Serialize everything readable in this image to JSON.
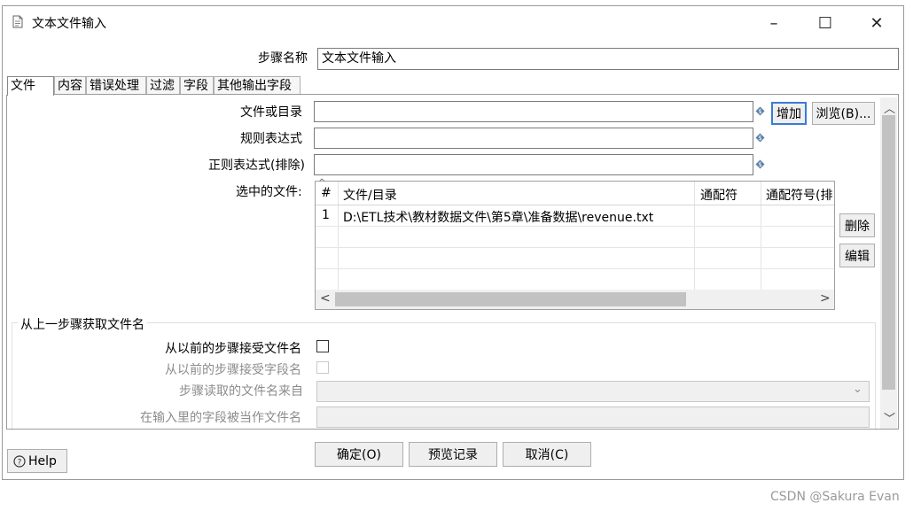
{
  "window": {
    "title": "文本文件输入",
    "controls": {
      "minimize": "–",
      "maximize": "☐",
      "close": "✕"
    }
  },
  "step_name": {
    "label": "步骤名称",
    "value": "文本文件输入"
  },
  "tabs": [
    {
      "label": "文件",
      "active": true
    },
    {
      "label": "内容"
    },
    {
      "label": "错误处理"
    },
    {
      "label": "过滤"
    },
    {
      "label": "字段"
    },
    {
      "label": "其他输出字段"
    }
  ],
  "file_tab": {
    "file_or_dir": {
      "label": "文件或目录",
      "value": ""
    },
    "regex": {
      "label": "规则表达式",
      "value": ""
    },
    "regex_exclude": {
      "label": "正则表达式(排除)",
      "value": ""
    },
    "add_button": "增加",
    "browse_button": "浏览(B)...",
    "selected_files_label": "选中的文件:",
    "table": {
      "headers": [
        "#",
        "文件/目录",
        "通配符",
        "通配符号(排"
      ],
      "rows": [
        {
          "num": "1",
          "path": "D:\\ETL技术\\教材数据文件\\第5章\\准备数据\\revenue.txt",
          "wildcard": "",
          "wildcard_exclude": ""
        }
      ]
    },
    "delete_button": "删除",
    "edit_button": "编辑"
  },
  "prev_step_group": {
    "title": "从上一步骤获取文件名",
    "accept_filenames": {
      "label": "从以前的步骤接受文件名",
      "checked": false
    },
    "accept_fieldnames": {
      "label": "从以前的步骤接受字段名",
      "checked": false
    },
    "step_source": {
      "label": "步骤读取的文件名来自",
      "value": ""
    },
    "field_as_filename": {
      "label": "在输入里的字段被当作文件名",
      "value": ""
    }
  },
  "footer": {
    "help": "Help",
    "ok": "确定(O)",
    "preview": "预览记录",
    "cancel": "取消(C)"
  },
  "watermark": "CSDN @Sakura Evan",
  "colors": {
    "focus_border": "#3a7bd5",
    "variable_icon": "#5b7fa8"
  }
}
